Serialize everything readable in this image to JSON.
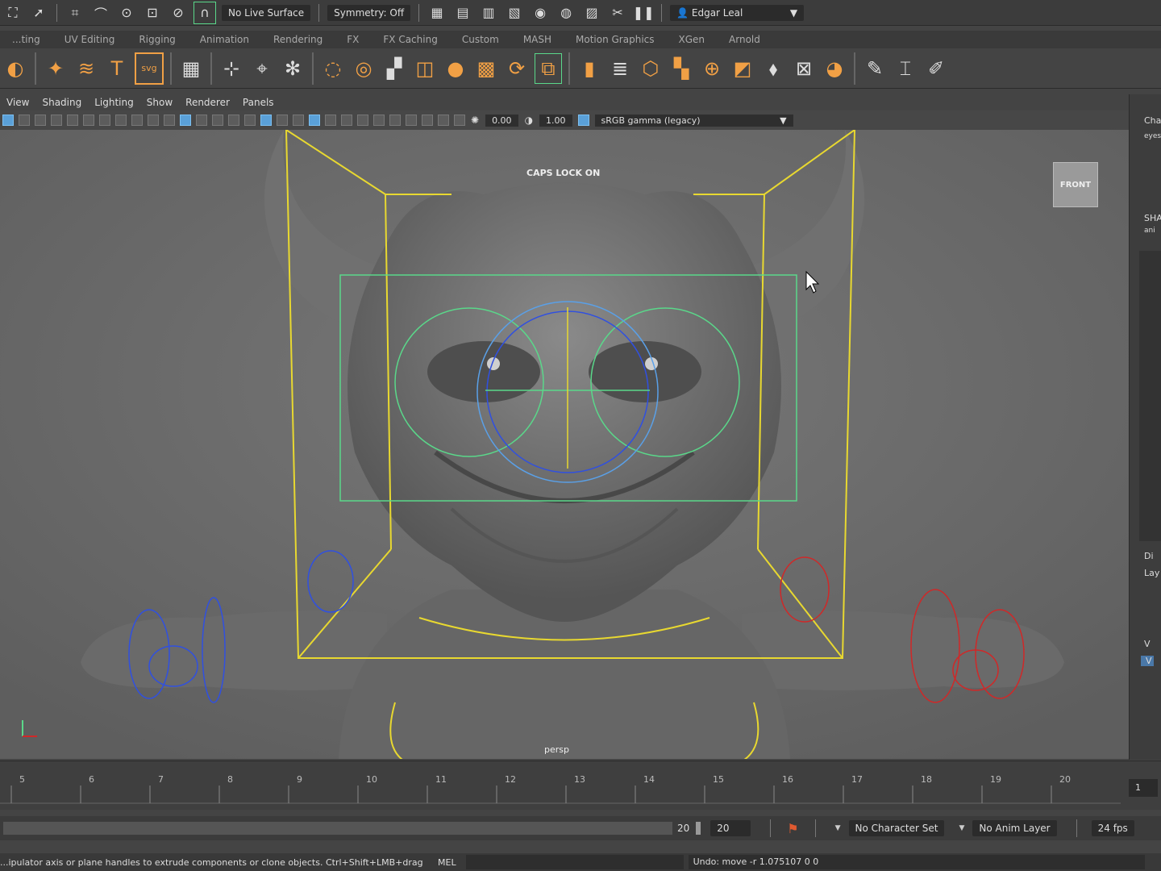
{
  "status_line": {
    "live_surface": "No Live Surface",
    "symmetry": "Symmetry: Off",
    "user": "Edgar Leal"
  },
  "shelf_tabs": [
    "...ting",
    "UV Editing",
    "Rigging",
    "Animation",
    "Rendering",
    "FX",
    "FX Caching",
    "Custom",
    "MASH",
    "Motion Graphics",
    "XGen",
    "Arnold"
  ],
  "shelf_icons": [
    "star-icon",
    "sweep-icon",
    "text-icon",
    "svg-icon",
    "grid-icon",
    "joint-icon",
    "locator-icon",
    "origin-icon",
    "torus-icon",
    "sphere-icon",
    "blocks-icon",
    "split-icon",
    "merge-icon",
    "array-icon",
    "sync-icon",
    "bridge-icon",
    "extrude-icon",
    "layers-icon",
    "cube-icon",
    "cluster-icon",
    "dial-icon",
    "duplicate-icon",
    "plane-icon",
    "frame-icon",
    "combine-icon",
    "pen-icon",
    "bounds-icon",
    "brush-icon"
  ],
  "viewport": {
    "menu": [
      "View",
      "Shading",
      "Lighting",
      "Show",
      "Renderer",
      "Panels"
    ],
    "exposure": "0.00",
    "gamma": "1.00",
    "color_space": "sRGB gamma (legacy)",
    "caps_lock": "CAPS LOCK ON",
    "camera": "persp",
    "viewcube": "FRONT"
  },
  "right_panel": {
    "label1": "Cha",
    "label2": "eyes",
    "label3": "SHA",
    "label4": "ani",
    "label5": "Di",
    "label6": "Lay",
    "label7": "V",
    "label8": "V"
  },
  "timeline": {
    "frames": [
      "5",
      "6",
      "7",
      "8",
      "9",
      "10",
      "11",
      "12",
      "13",
      "14",
      "15",
      "16",
      "17",
      "18",
      "19",
      "20"
    ],
    "current_frame": "1"
  },
  "range": {
    "end_a": "20",
    "end_b": "20",
    "character_set": "No Character Set",
    "anim_layer": "No Anim Layer",
    "fps": "24 fps"
  },
  "command_line": {
    "help": "...ipulator axis or plane handles to extrude components or clone objects. Ctrl+Shift+LMB+drag to constrain",
    "lang": "MEL",
    "result": "Undo: move -r 1.075107 0 0"
  },
  "colors": {
    "control_yellow": "#e8d830",
    "control_green": "#5ad88a",
    "control_blue": "#3050e0",
    "control_red": "#d02828",
    "shelf_orange": "#f1a045"
  }
}
